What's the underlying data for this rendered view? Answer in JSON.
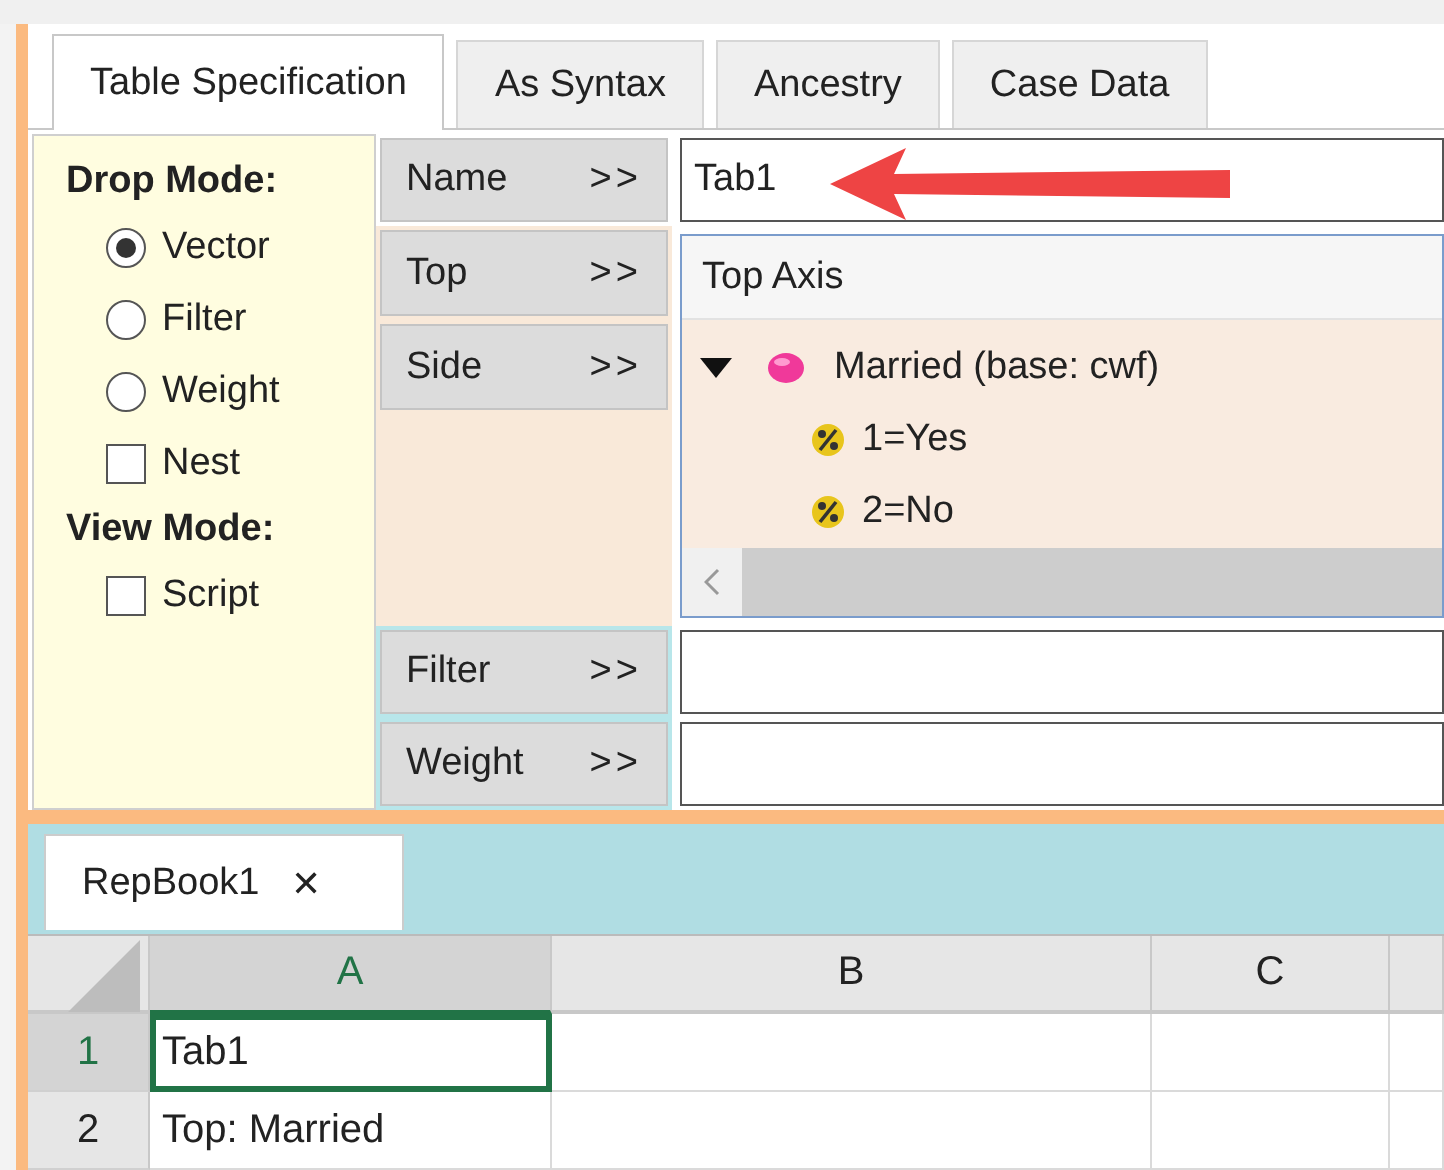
{
  "tabs": [
    {
      "label": "Table Specification",
      "selected": true
    },
    {
      "label": "As Syntax",
      "selected": false
    },
    {
      "label": "Ancestry",
      "selected": false
    },
    {
      "label": "Case Data",
      "selected": false
    }
  ],
  "drop_mode": {
    "label": "Drop Mode:",
    "options": [
      {
        "label": "Vector",
        "kind": "radio",
        "checked": true
      },
      {
        "label": "Filter",
        "kind": "radio",
        "checked": false
      },
      {
        "label": "Weight",
        "kind": "radio",
        "checked": false
      },
      {
        "label": "Nest",
        "kind": "checkbox",
        "checked": false
      }
    ]
  },
  "view_mode": {
    "label": "View Mode:",
    "options": [
      {
        "label": "Script",
        "kind": "checkbox",
        "checked": false
      }
    ]
  },
  "name_row": {
    "button": {
      "label": "Name",
      "arrows": ">>"
    },
    "value": "Tab1"
  },
  "axis_buttons": [
    {
      "label": "Top",
      "arrows": ">>"
    },
    {
      "label": "Side",
      "arrows": ">>"
    }
  ],
  "axis_panel": {
    "title": "Top Axis",
    "tree": [
      {
        "label": "Married (base: cwf)",
        "expanded": true,
        "children": [
          {
            "label": "1=Yes"
          },
          {
            "label": "2=No"
          }
        ]
      }
    ]
  },
  "filter_row": {
    "button": {
      "label": "Filter",
      "arrows": ">>"
    }
  },
  "weight_row": {
    "button": {
      "label": "Weight",
      "arrows": ">>"
    }
  },
  "doc_tab": {
    "label": "RepBook1",
    "close": "✕"
  },
  "sheet": {
    "columns": [
      {
        "label": "A",
        "selected": true
      },
      {
        "label": "B",
        "selected": false
      },
      {
        "label": "C",
        "selected": false
      }
    ],
    "rows": [
      {
        "number": "1",
        "selected": true,
        "cells": [
          "Tab1"
        ]
      },
      {
        "number": "2",
        "selected": false,
        "cells": [
          "Top: Married"
        ]
      }
    ]
  }
}
